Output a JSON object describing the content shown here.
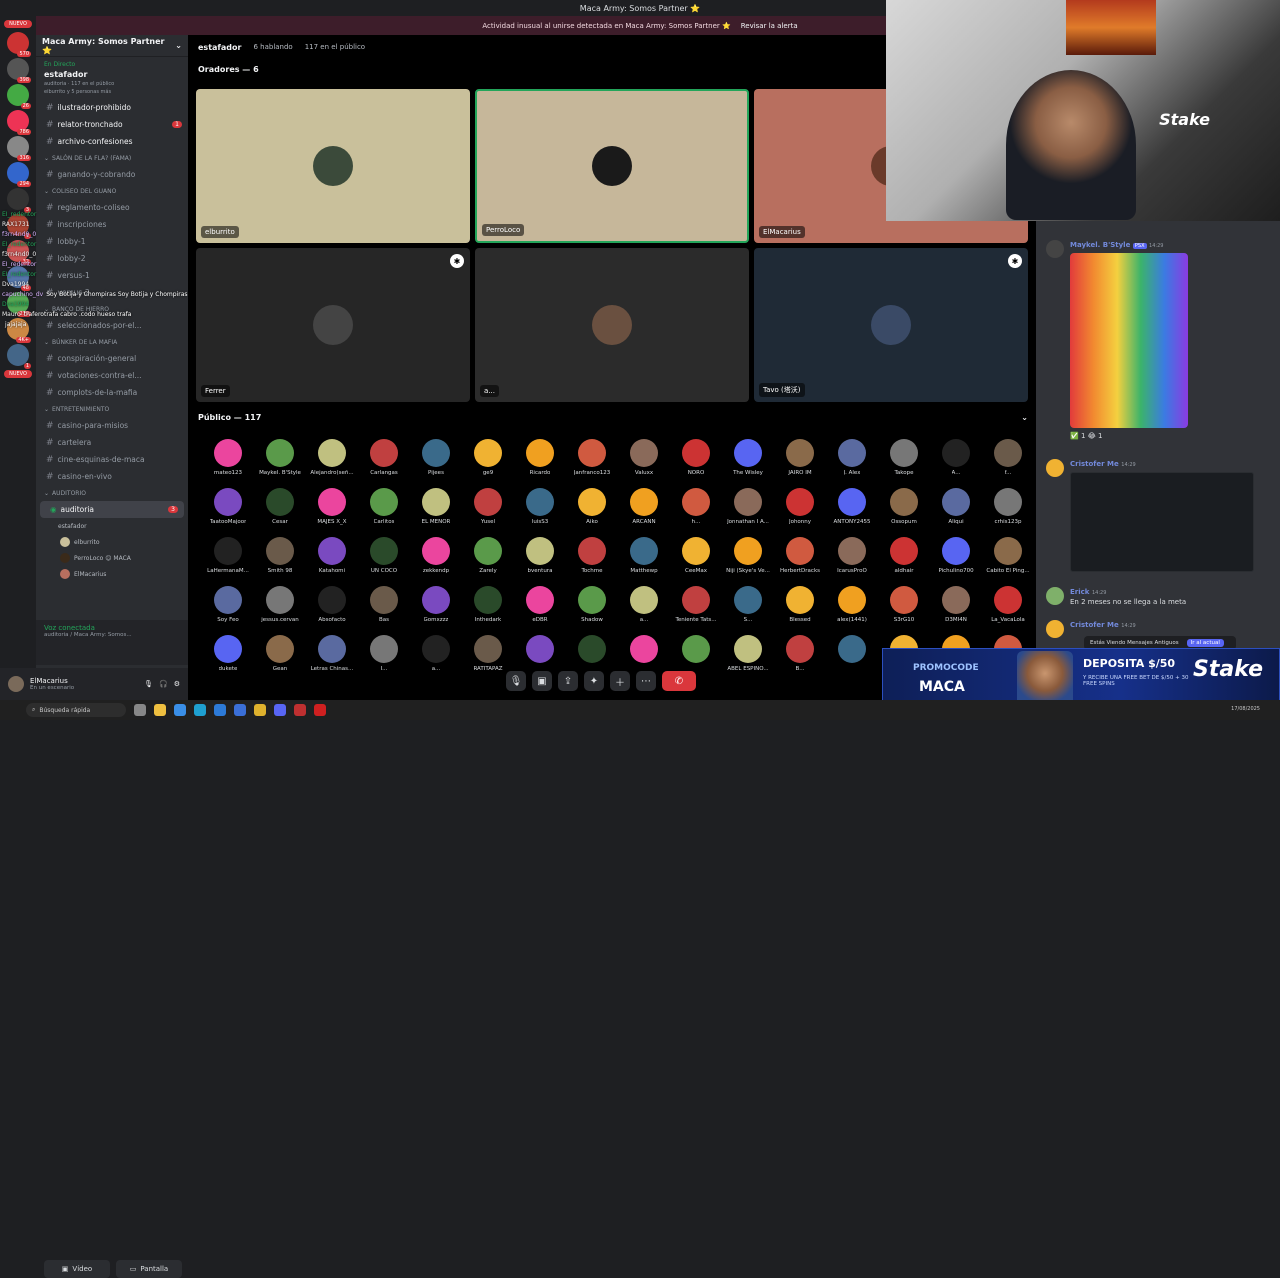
{
  "title_bar": "Maca Army: Somos Partner ⭐",
  "notice": {
    "text": "Actividad inusual al unirse detectada en Maca Army: Somos Partner ⭐",
    "link": "Revisar la alerta"
  },
  "rail": {
    "new_top": "NUEVO",
    "new_bottom": "NUEVO",
    "badges": [
      "570",
      "398",
      "26",
      "786",
      "316",
      "294",
      "3",
      "1",
      "32",
      "48",
      "279",
      "4K+",
      "1"
    ]
  },
  "server": {
    "name": "Maca Army: Somos Partner ⭐"
  },
  "stage_live": {
    "status": "En Directo",
    "title": "estafador",
    "meta": "auditoria · 117 en el público",
    "speakers": "eiburrito y 5 personas más"
  },
  "channels_top": [
    {
      "name": "ilustrador-prohibido",
      "badge": ""
    },
    {
      "name": "relator-tronchado",
      "badge": "1"
    },
    {
      "name": "archivo-confesiones",
      "badge": ""
    }
  ],
  "categories": [
    {
      "name": "SALÓN DE LA FLA? (FAMA)",
      "channels": [
        "ganando-y-cobrando"
      ]
    },
    {
      "name": "COLISEO DEL GUANO",
      "channels": [
        "reglamento-coliseo",
        "inscripciones",
        "lobby-1",
        "lobby-2",
        "versus-1",
        "versus-2"
      ]
    },
    {
      "name": "BANCO DE HIERRO",
      "channels": [
        "seleccionados-por-el..."
      ]
    },
    {
      "name": "BÚNKER DE LA MAFIA",
      "channels": [
        "conspiración-general",
        "votaciones-contra-el...",
        "complots-de-la-mafia"
      ]
    },
    {
      "name": "ENTRETENIMIENTO",
      "channels": [
        "casino-para-misios",
        "cartelera",
        "cine-esquinas-de-maca",
        "casino-en-vivo"
      ]
    },
    {
      "name": "AUDITORIO",
      "channels": []
    }
  ],
  "stage_channel": {
    "name": "auditoria",
    "badge": "3",
    "subtitle": "estafador",
    "users": [
      "elburrito",
      "PerroLoco 😊 MACA",
      "ElMacarius"
    ]
  },
  "overlay_chat": [
    {
      "user": "EI_redentor",
      "text": ""
    },
    {
      "user": "RAX1731",
      "text": ""
    },
    {
      "user": "f3rn4nd0_0",
      "text": ""
    },
    {
      "user": "EI_redentor",
      "text": ""
    },
    {
      "user": "f3rn4nd0_0",
      "text": ""
    },
    {
      "user": "EI_redentor",
      "text": ""
    },
    {
      "user": "EI_redentor",
      "text": ""
    },
    {
      "user": "Dva1994",
      "text": ""
    },
    {
      "user": "capuchino_dv",
      "text": "Soy Botija y Chompiras Soy Botija y Chompiras Soy Botija y Chompiras"
    },
    {
      "user": "Dva1994",
      "text": ""
    },
    {
      "user": "Mauro",
      "text": "traferotrafa cabro .codo hueso trafa"
    },
    {
      "user": "",
      "text": "jajajaja"
    }
  ],
  "voice": {
    "status": "Voz conectada",
    "where": "auditoria / Maca Army: Somos...",
    "video": "Vídeo",
    "screen": "Pantalla"
  },
  "userbar": {
    "name": "ElMacarius",
    "status": "En un escenario"
  },
  "stage_header": {
    "name": "estafador",
    "speaking": "6 hablando",
    "audience": "117 en el público"
  },
  "speakers_label": "Oradores — 6",
  "tiles": [
    {
      "label": "elburrito",
      "bg": "#c9c09b"
    },
    {
      "label": "PerroLoco",
      "bg": "#c6b79a"
    },
    {
      "label": "ElMacarius",
      "bg": "#b86f5f"
    },
    {
      "label": "Ferrer",
      "bg": "#262626"
    },
    {
      "label": "a...",
      "bg": "#2b2b2b"
    },
    {
      "label": "Tavo (塔沃)",
      "bg": "#1f2a36"
    }
  ],
  "audience_label": "Público — 117",
  "audience": [
    "mateo123",
    "Maykel. B'Style",
    "Alejandro(señ...",
    "Carlangas",
    "Pijees",
    "ge9",
    "Ricardo",
    "Janfranco123",
    "Valuxx",
    "NORO",
    "The Wisley",
    "JAIRO IM",
    "J. Alex",
    "Takope",
    "A...",
    "f...",
    "TaatooMajoor",
    "Cesar",
    "MAJES X_X",
    "Carlitos",
    "EL MENOR",
    "Yusel",
    "luisS3",
    "Aiko",
    "ARCANN",
    "h...",
    "Jonnathan I A...",
    "Johonny",
    "ANTONY2455",
    "Ossopum",
    "Aliqui",
    "crhis123p",
    "LaHermanaM...",
    "Smith 98",
    "Katahomi",
    "UN COCO",
    "zekkendp",
    "Zarely",
    "bventura",
    "Tochme",
    "Matthewp",
    "CeeMax",
    "Niji (Skye's Ve...",
    "HerbertDracks",
    "IcarusProO",
    "aldhair",
    "Pichulino700",
    "Cabito El Ping...",
    "Soy Feo",
    "jessus.cervan",
    "Absofacto",
    "Bas",
    "Gomxzzz",
    "Inthedark",
    "eDBR",
    "Shadow",
    "a...",
    "Teniente Tats...",
    "S...",
    "Blessed",
    "alex(1441)",
    "S3rG10",
    "D3MI4N",
    "La_VacaLola",
    "dukete",
    "Gean",
    "Letras Chinas...",
    "I...",
    "a...",
    "RATITAPAZ",
    "",
    "",
    "",
    "",
    "ABEL ESPINO...",
    "B...",
    "",
    "",
    "",
    ""
  ],
  "chat": {
    "msg1_user": "Maykel. B'Style",
    "msg1_tag": "PSX",
    "msg1_time": "14:29",
    "reactions": "✅ 1   😂 1",
    "msg2_user": "Cristofer Me",
    "msg2_time": "14:29",
    "msg3_user": "Erick",
    "msg3_time": "14:29",
    "msg3_text": "En 2 meses no se llega a la meta",
    "msg4_user": "Cristofer Me",
    "msg4_time": "14:29",
    "new_messages": "Estás Viendo Mensajes Antiguos",
    "jump": "Ir al actual"
  },
  "promo": {
    "line1": "PROMOCODE",
    "line2": "MACA",
    "line3": "DEPOSITA $/50",
    "line4": "Y RECIBE UNA FREE BET DE $/50 + 30 FREE SPINS",
    "brand": "Stake"
  },
  "webcam_brand": "Stake",
  "taskbar": {
    "search": "Búsqueda rápida",
    "clock": "17/08/2025"
  }
}
